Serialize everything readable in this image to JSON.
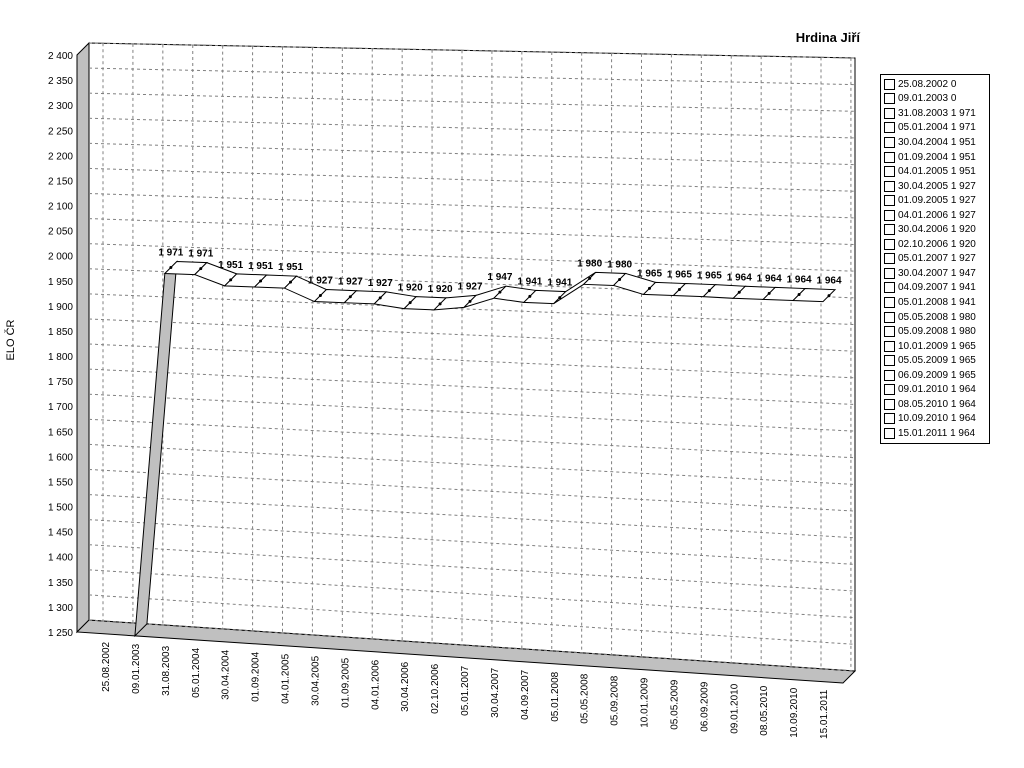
{
  "chart_data": {
    "type": "line",
    "title": "Hrdina Jiří",
    "ylabel": "ELO ČR",
    "xlabel": "",
    "ylim": [
      1250,
      2400
    ],
    "yticks": [
      "2 400",
      "2 350",
      "2 300",
      "2 250",
      "2 200",
      "2 150",
      "2 100",
      "2 050",
      "2 000",
      "1 950",
      "1 900",
      "1 850",
      "1 800",
      "1 750",
      "1 700",
      "1 650",
      "1 600",
      "1 550",
      "1 500",
      "1 450",
      "1 400",
      "1 350",
      "1 300",
      "1 250"
    ],
    "ytick_values": [
      2400,
      2350,
      2300,
      2250,
      2200,
      2150,
      2100,
      2050,
      2000,
      1950,
      1900,
      1850,
      1800,
      1750,
      1700,
      1650,
      1600,
      1550,
      1500,
      1450,
      1400,
      1350,
      1300,
      1250
    ],
    "categories": [
      "25.08.2002",
      "09.01.2003",
      "31.08.2003",
      "05.01.2004",
      "30.04.2004",
      "01.09.2004",
      "04.01.2005",
      "30.04.2005",
      "01.09.2005",
      "04.01.2006",
      "30.04.2006",
      "02.10.2006",
      "05.01.2007",
      "30.04.2007",
      "04.09.2007",
      "05.01.2008",
      "05.05.2008",
      "05.09.2008",
      "10.01.2009",
      "05.05.2009",
      "06.09.2009",
      "09.01.2010",
      "08.05.2010",
      "10.09.2010",
      "15.01.2011"
    ],
    "values": [
      0,
      0,
      1971,
      1971,
      1951,
      1951,
      1951,
      1927,
      1927,
      1927,
      1920,
      1920,
      1927,
      1947,
      1941,
      1941,
      1980,
      1980,
      1965,
      1965,
      1965,
      1964,
      1964,
      1964,
      1964
    ],
    "data_labels": [
      "",
      "",
      "1 971",
      "1 971",
      "1 951",
      "1 951",
      "1 951",
      "1 927",
      "1 927",
      "1 927",
      "1 920",
      "1 920",
      "1 927",
      "1 947",
      "1 941",
      "1 941",
      "1 980",
      "1 980",
      "1 965",
      "1 965",
      "1 965",
      "1 964",
      "1 964",
      "1 964",
      "1 964"
    ],
    "grid": true,
    "legend_position": "right",
    "legend": [
      "25.08.2002 0",
      "09.01.2003 0",
      "31.08.2003 1 971",
      "05.01.2004 1 971",
      "30.04.2004 1 951",
      "01.09.2004 1 951",
      "04.01.2005 1 951",
      "30.04.2005 1 927",
      "01.09.2005 1 927",
      "04.01.2006 1 927",
      "30.04.2006 1 920",
      "02.10.2006 1 920",
      "05.01.2007 1 927",
      "30.04.2007 1 947",
      "04.09.2007 1 941",
      "05.01.2008 1 941",
      "05.05.2008 1 980",
      "05.09.2008 1 980",
      "10.01.2009 1 965",
      "05.05.2009 1 965",
      "06.09.2009 1 965",
      "09.01.2010 1 964",
      "08.05.2010 1 964",
      "10.09.2010 1 964",
      "15.01.2011 1 964"
    ],
    "colors": {
      "line_fill": "#ffffff",
      "line_stroke": "#000000",
      "wall": "#c0c0c0",
      "grid": "#808080"
    }
  }
}
